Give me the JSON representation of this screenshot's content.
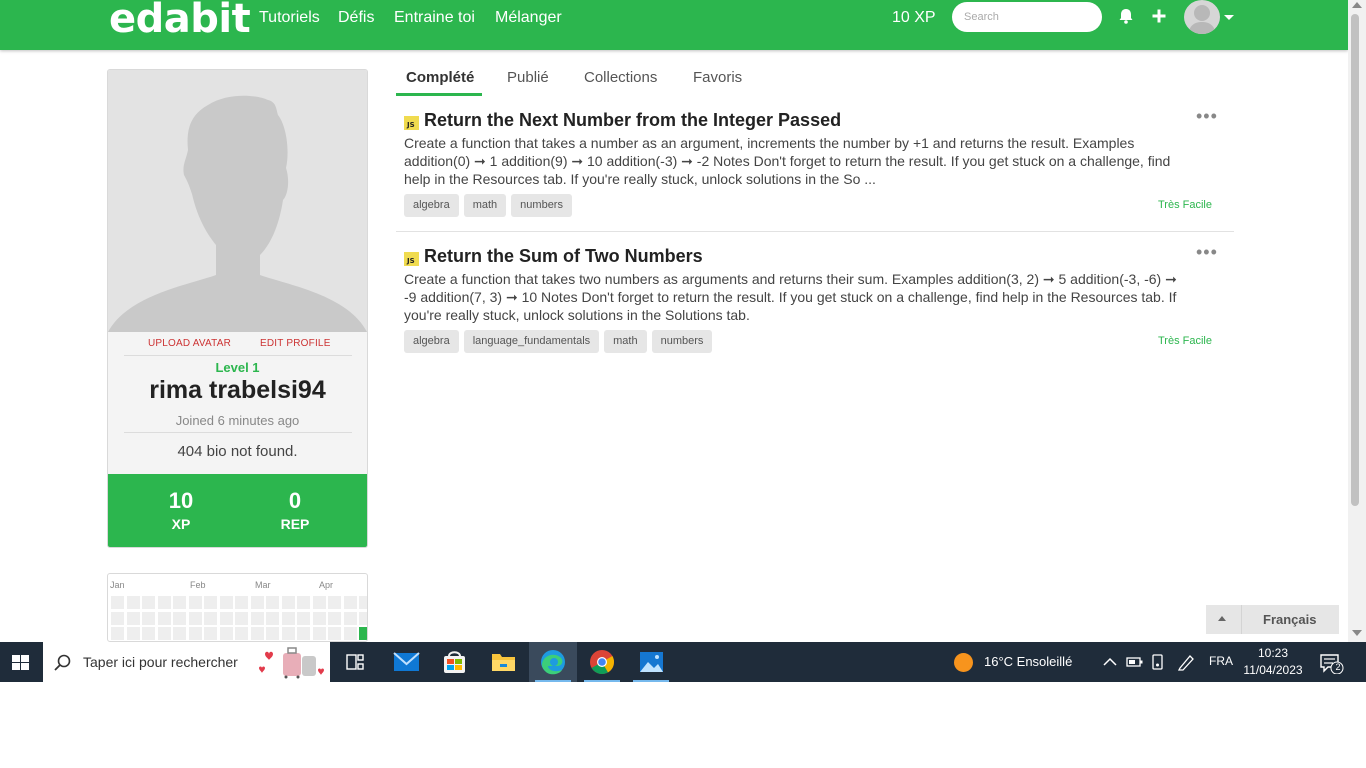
{
  "nav": {
    "logo": "edabit",
    "links": [
      "Tutoriels",
      "Défis",
      "Entraine toi",
      "Mélanger"
    ],
    "xp": "10 XP",
    "search_placeholder": "Search"
  },
  "profile": {
    "upload_avatar": "UPLOAD AVATAR",
    "edit_profile": "EDIT PROFILE",
    "level": "Level 1",
    "username": "rima trabelsi94",
    "joined": "Joined 6 minutes ago",
    "bio": "404 bio not found.",
    "xp_value": "10",
    "xp_label": "XP",
    "rep_value": "0",
    "rep_label": "REP"
  },
  "activity": {
    "months": [
      "Jan",
      "Feb",
      "Mar",
      "Apr"
    ]
  },
  "tabs": [
    "Complété",
    "Publié",
    "Collections",
    "Favoris"
  ],
  "challenges": [
    {
      "lang_badge": "JS",
      "title": "Return the Next Number from the Integer Passed",
      "description": "Create a function that takes a number as an argument, increments the number by +1 and returns the result. Examples addition(0) ➞ 1 addition(9) ➞ 10 addition(-3) ➞ -2 Notes Don't forget to return the result. If you get stuck on a challenge, find help in the Resources tab. If you're really stuck, unlock solutions in the So ...",
      "tags": [
        "algebra",
        "math",
        "numbers"
      ],
      "difficulty": "Très Facile",
      "more": "•••"
    },
    {
      "lang_badge": "JS",
      "title": "Return the Sum of Two Numbers",
      "description": "Create a function that takes two numbers as arguments and returns their sum. Examples addition(3, 2) ➞ 5 addition(-3, -6) ➞ -9 addition(7, 3) ➞ 10 Notes Don't forget to return the result. If you get stuck on a challenge, find help in the Resources tab. If you're really stuck, unlock solutions in the Solutions tab.",
      "tags": [
        "algebra",
        "language_fundamentals",
        "math",
        "numbers"
      ],
      "difficulty": "Très Facile",
      "more": "•••"
    }
  ],
  "language": "Français",
  "taskbar": {
    "search_text": "Taper ici pour rechercher",
    "weather": "16°C  Ensoleillé",
    "lang": "FRA",
    "time": "10:23",
    "date": "11/04/2023",
    "notifications": "2"
  },
  "colors": {
    "brand_green": "#2cb64e",
    "taskbar": "#1f2c3a",
    "link_red": "#cc3333"
  }
}
